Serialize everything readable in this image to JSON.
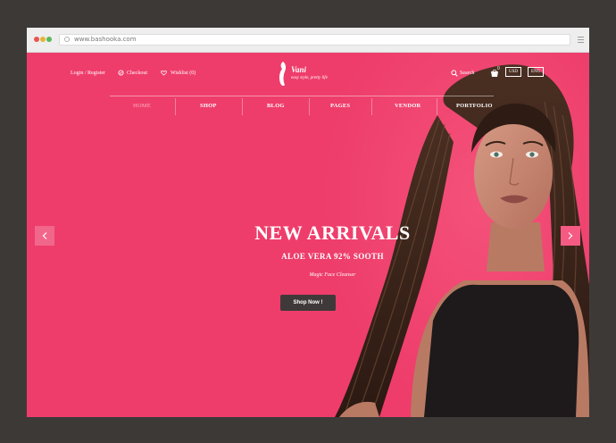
{
  "browser": {
    "url": "www.bashooka.com"
  },
  "topbar": {
    "login": "Login / Register",
    "checkout": "Checkout",
    "wishlist": "Wishlist (0)",
    "search": "Search",
    "cart_count": "0",
    "currency": "USD",
    "language": "ENG"
  },
  "logo": {
    "name": "Vani",
    "tagline": "easy style, pretty life"
  },
  "nav": {
    "items": [
      "HOME",
      "SHOP",
      "BLOG",
      "PAGES",
      "VENDOR",
      "PORTFOLIO"
    ]
  },
  "hero": {
    "headline": "NEW ARRIVALS",
    "subheadline": "ALOE VERA 92% SOOTH",
    "caption": "Magic Face Cleanser",
    "cta": "Shop Now !"
  },
  "colors": {
    "accent": "#ee3d6b",
    "button": "#3f3a39",
    "frame": "#3d3937"
  },
  "icons": [
    "browser-menu-icon",
    "lock-icon",
    "checkout-icon",
    "heart-icon",
    "search-icon",
    "cart-icon",
    "chevron-left-icon",
    "chevron-right-icon"
  ]
}
